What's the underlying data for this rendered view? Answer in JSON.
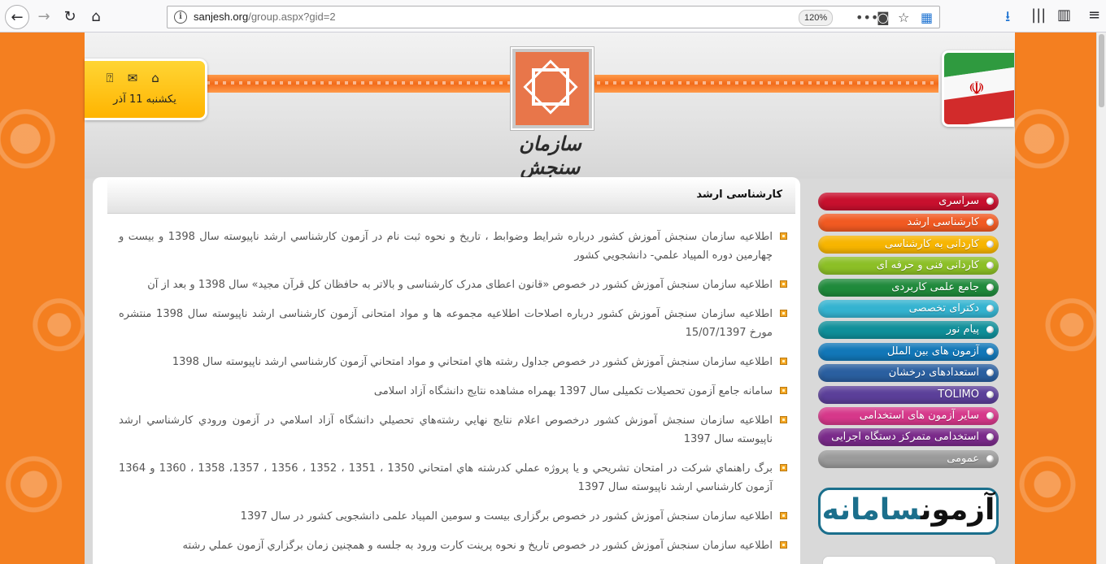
{
  "browser": {
    "url_host": "sanjesh.org",
    "url_path": "/group.aspx?gid=2",
    "zoom": "120%"
  },
  "header": {
    "date": "یکشنبه 11 آذر",
    "org_name": "سازمان سنجش آموزش کشور"
  },
  "content": {
    "title": "کارشناسی ارشد",
    "news": [
      "اطلاعيه سازمان سنجش آموزش کشور درباره شرايط وضوابط ، تاريخ و نحوه ثبت نام در آزمون کارشناسي ارشد ناپيوسته سال 1398 و بيست و چهارمين دوره المپياد علمي- دانشجويي کشور",
      "اطلاعیه سازمان سنجش آموزش کشور در خصوص «قانون اعطای مدرک کارشناسی و بالاتر به حافظان کل قرآن مجید» سال 1398 و بعد از آن",
      "اطلاعیه سازمان سنجش آموزش کشور درباره اصلاحات اطلاعیه مجموعه ها و مواد امتحانی آزمون کارشناسی ارشد ناپیوسته سال 1398 منتشره مورخ 15/07/1397",
      "اطلاعيه سازمان سنجش آموزش كشور در خصوص جداول رشته هاي امتحاني و مواد امتحاني آزمون كارشناسي ارشد ناپيوسته سال 1398",
      "سامانه جامع آزمون تحصیلات تکمیلی سال 1397 بهمراه مشاهده نتایج دانشگاه آزاد اسلامی",
      "اطلاعيه سازمان سنجش آموزش كشور درخصوص اعلام نتايج نهايي رشته‌هاي تحصيلي دانشگاه آزاد اسلامي در آزمون ورودي كارشناسي ارشد ناپيوسته سال 1397",
      "برگ راهنماي شرکت در امتحان تشريحي و يا پروژه عملي کدرشته هاي امتحاني 1350 ، 1351 ، 1352 ، 1356 ، 1357، 1358 ، 1360 و 1364 آزمون کارشناسي ارشد ناپيوسته سال 1397",
      "اطلاعیه سازمان سنجش آموزش کشور در خصوص برگزاری بیست و سومین المپیاد علمی دانشجویی کشور در سال 1397",
      "اطلاعيه سازمان سنجش آموزش كشور در خصوص تاريخ و نحوه پرينت كارت ورود به جلسه و همچنين زمان برگزاري آزمون عملي رشته"
    ]
  },
  "menu": {
    "items": [
      {
        "label": "سراسری",
        "color": "#c8102e"
      },
      {
        "label": "کارشناسی ارشد",
        "color": "#f15a22"
      },
      {
        "label": "کاردانی به کارشناسی",
        "color": "#f7b500"
      },
      {
        "label": "کاردانی فنی و حرفه ای",
        "color": "#8cbf26"
      },
      {
        "label": "جامع علمی کاربردی",
        "color": "#1f8a3b"
      },
      {
        "label": "دکترای تخصصی",
        "color": "#34b3d0"
      },
      {
        "label": "پیام نور",
        "color": "#0f8f9a"
      },
      {
        "label": "آزمون های بین الملل",
        "color": "#1277b8"
      },
      {
        "label": "استعدادهای درخشان",
        "color": "#2a5fa0"
      },
      {
        "label": "TOLIMO",
        "color": "#5b3f99"
      },
      {
        "label": "سایر آزمون های استخدامی",
        "color": "#d6388a"
      },
      {
        "label": "استخدامی متمرکز دستگاه اجرایی",
        "color": "#7a2a8a"
      },
      {
        "label": "عمومی",
        "color": "#9a9a9a"
      }
    ]
  },
  "banner": {
    "text_black": "آزمون",
    "text_blue": "سامانه"
  }
}
